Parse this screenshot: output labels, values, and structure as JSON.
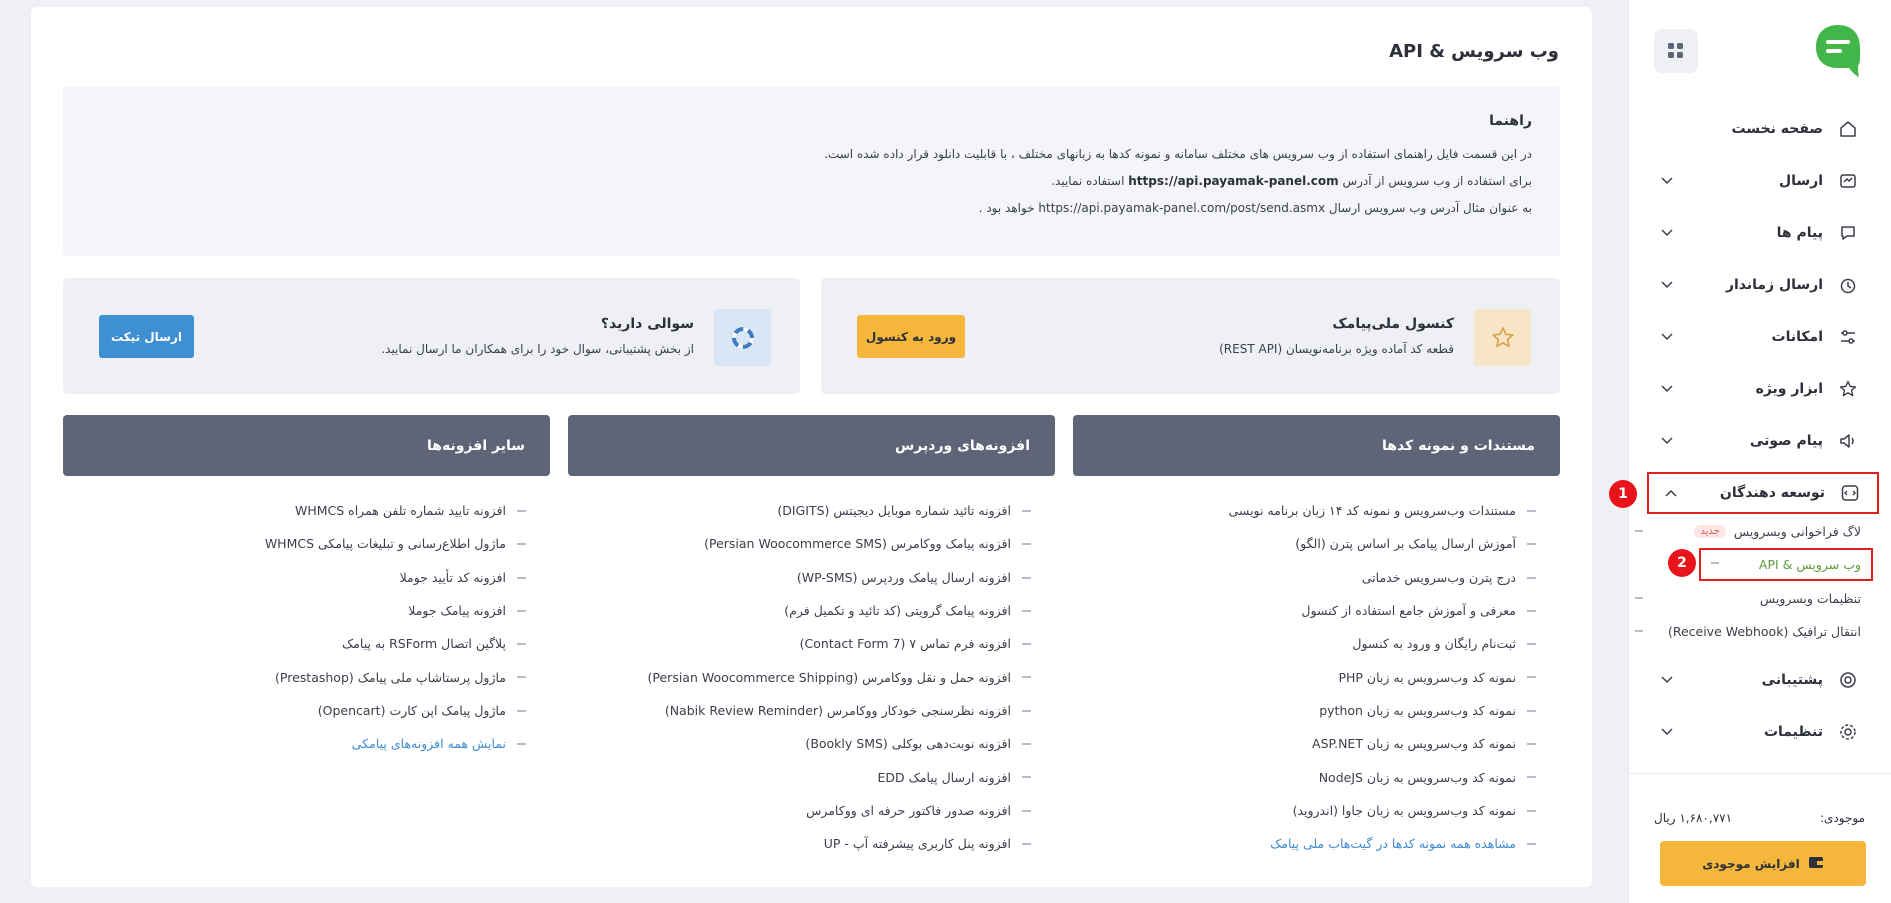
{
  "sidebar": {
    "nav": [
      {
        "label": "صفحه نخست",
        "icon": "home-icon",
        "has_children": false
      },
      {
        "label": "ارسال",
        "icon": "send-icon",
        "has_children": true
      },
      {
        "label": "پیام ها",
        "icon": "messages-icon",
        "has_children": true
      },
      {
        "label": "ارسال زماندار",
        "icon": "scheduled-send-icon",
        "has_children": true
      },
      {
        "label": "امکانات",
        "icon": "features-icon",
        "has_children": true
      },
      {
        "label": "ابزار ویژه",
        "icon": "star-tools-icon",
        "has_children": true
      },
      {
        "label": "پیام صوتی",
        "icon": "voice-message-icon",
        "has_children": true
      },
      {
        "label": "توسعه دهندگان",
        "icon": "code-icon",
        "has_children": true,
        "expanded": true
      },
      {
        "label": "پشتیبانی",
        "icon": "support-icon",
        "has_children": true
      },
      {
        "label": "تنظیمات",
        "icon": "settings-icon",
        "has_children": true
      }
    ],
    "developer_sub": [
      {
        "label": "لاگ فراخوانی وبسرویس",
        "badge": "جدید"
      },
      {
        "label": "وب سرویس & API",
        "active": true
      },
      {
        "label": "تنظیمات وبسرویس"
      },
      {
        "label": "انتقال ترافیک (Receive Webhook)"
      }
    ],
    "markers": [
      "1",
      "2"
    ],
    "wallet": {
      "label": "موجودی:",
      "value": "۱,۶۸۰,۷۷۱ ریال",
      "button": "افزایش موجودی"
    }
  },
  "main": {
    "title": "وب سرویس & API",
    "guide": {
      "title": "راهنما",
      "line1": "در این قسمت فایل راهنمای استفاده از وب سرویس های مختلف سامانه و نمونه کدها به زبانهای مختلف ، با قابلیت دانلود قرار داده شده است.",
      "line2_prefix": "برای استفاده از وب سرویس از آدرس",
      "line2_url": "https://api.payamak-panel.com",
      "line2_suffix": "استفاده نمایید.",
      "line3": "به عنوان مثال آدرس وب سرویس ارسال https://api.payamak-panel.com/post/send.asmx خواهد بود ."
    },
    "console_card": {
      "title": "کنسول ملی‌پیامک",
      "desc": "قطعه کد آماده ویژه برنامه‌نویسان (REST API)",
      "button": "ورود به کنسول"
    },
    "question_card": {
      "title": "سوالی دارید؟",
      "desc": "از بخش پشتیبانی، سوال خود را برای همکاران ما ارسال نمایید.",
      "button": "ارسال تیکت"
    },
    "columns": [
      {
        "title": "مستندات و نمونه کدها",
        "items": [
          "مستندات وب‌سرویس و نمونه کد ۱۴ زبان برنامه نویسی",
          "آموزش ارسال پیامک بر اساس پترن (الگو)",
          "درج پترن وب‌سرویس خدماتی",
          "معرفی و آموزش جامع استفاده از کنسول",
          "ثبت‌نام رایگان و ورود به کنسول",
          "نمونه کد وب‌سرویس به زبان PHP",
          "نمونه کد وب‌سرویس به زبان python",
          "نمونه کد وب‌سرویس به زبان ASP.NET",
          "نمونه کد وب‌سرویس به زبان NodeJS",
          "نمونه کد وب‌سرویس به زبان جاوا (اندروید)"
        ],
        "link": "مشاهده همه نمونه کدها در گیت‌هاب ملی پیامک"
      },
      {
        "title": "افزونه‌های وردپرس",
        "items": [
          "افزونه تائید شماره موبایل دیجیتس (DIGITS)",
          "افزونه پیامک ووکامرس (Persian Woocommerce SMS)",
          "افزونه ارسال پیامک وردپرس (WP-SMS)",
          "افزونه پیامک گرویتی (کد تائید و تکمیل فرم)",
          "افزونه فرم تماس ۷ (Contact Form 7)",
          "افزونه حمل و نقل ووکامرس (Persian Woocommerce Shipping)",
          "افزونه نظرسنجی خودکار ووکامرس (Nabik Review Reminder)",
          "افزونه نوبت‌دهی بوکلی (Bookly SMS)",
          "افزونه ارسال پیامک EDD",
          "افزونه صدور فاکتور حرفه ای ووکامرس",
          "افزونه پنل کاربری پیشرفته آپ - UP"
        ]
      },
      {
        "title": "سایر افزونه‌ها",
        "items": [
          "افزونه تایید شماره تلفن همراه WHMCS",
          "ماژول اطلاع‌رسانی و تبلیغات پیامکی WHMCS",
          "افزونه کد تأیید جوملا",
          "افزونه پیامک جوملا",
          "پلاگین اتصال RSForm به پیامک",
          "ماژول پرستاشاپ ملی پیامک (Prestashop)",
          "ماژول پیامک اپن کارت (Opencart)"
        ],
        "link": "نمایش همه افزونه‌های پیامکی"
      }
    ]
  },
  "colors": {
    "accent_yellow": "#f4b73b",
    "accent_blue": "#3f8fd3",
    "header_gray": "#5f6576",
    "highlight_red": "#e02020",
    "active_green": "#5f9c3f"
  }
}
